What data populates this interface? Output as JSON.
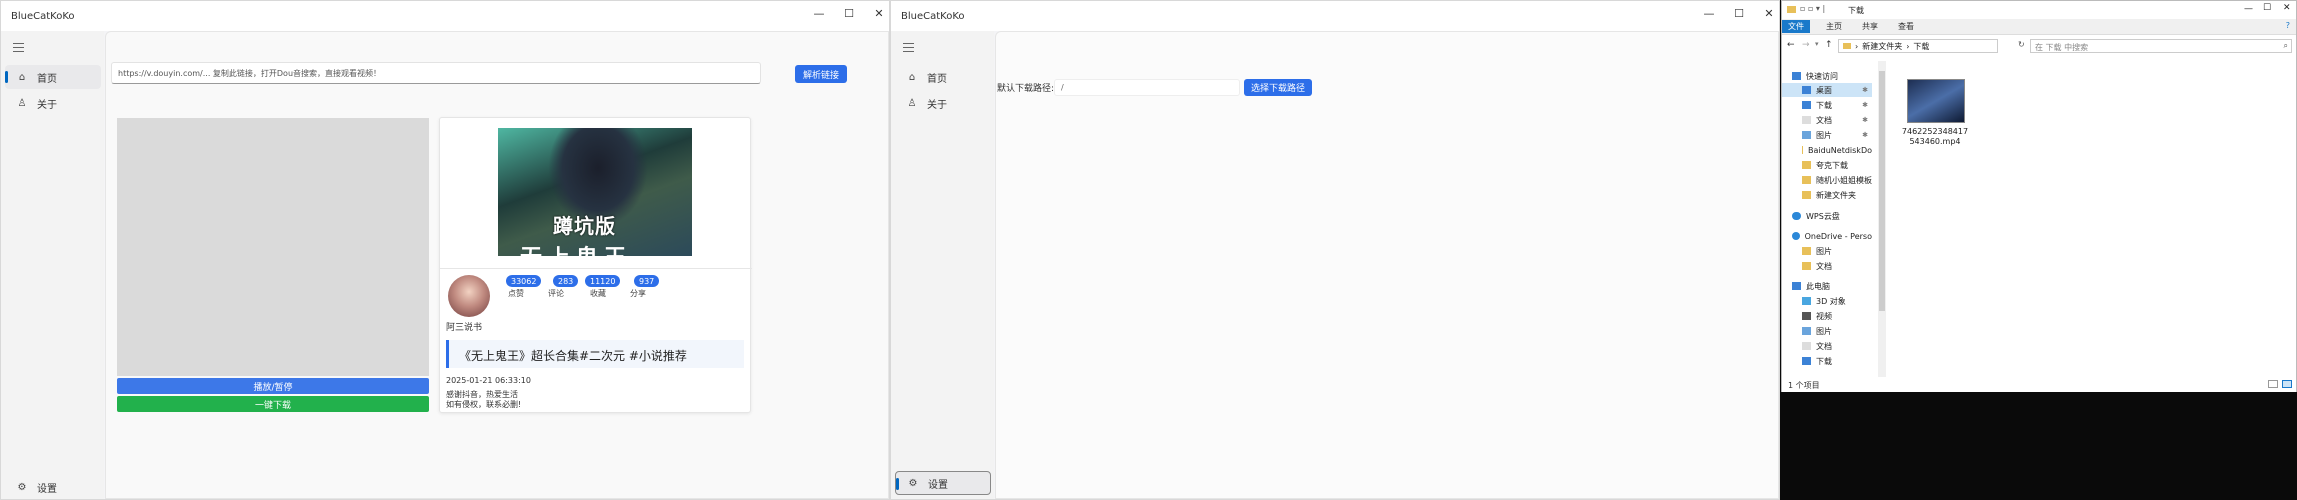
{
  "window1": {
    "title": "BlueCatKoKo",
    "controls": {
      "minimize": "—",
      "maximize": "☐",
      "close": "✕"
    },
    "nav": [
      {
        "icon": "home-icon",
        "glyph": "⌂",
        "label": "首页"
      },
      {
        "icon": "user-icon",
        "glyph": "♙",
        "label": "关于"
      }
    ],
    "settings": {
      "glyph": "⚙",
      "label": "设置"
    },
    "url_input_value": "https://v.douyin.com/... 复制此链接，打开Dou音搜索，直接观看视频！",
    "parse_button": "解析链接",
    "play_button": "播放/暂停",
    "download_button": "一键下载",
    "cover_text": "蹲坑版",
    "cover_text_sub": "无上鬼王",
    "stats": [
      {
        "value": "33062",
        "label": "点赞"
      },
      {
        "value": "283",
        "label": "评论"
      },
      {
        "value": "11120",
        "label": "收藏"
      },
      {
        "value": "937",
        "label": "分享"
      }
    ],
    "author": "阿三说书",
    "video_title": "《无上鬼王》超长合集#二次元 #小说推荐",
    "date": "2025-01-21 06:33:10",
    "desc_line1": "感谢抖音，热爱生活",
    "desc_line2": "如有侵权，联系必删!"
  },
  "window2": {
    "title": "BlueCatKoKo",
    "controls": {
      "minimize": "—",
      "maximize": "☐",
      "close": "✕"
    },
    "nav": [
      {
        "icon": "home-icon",
        "glyph": "⌂",
        "label": "首页"
      },
      {
        "icon": "user-icon",
        "glyph": "♙",
        "label": "关于"
      }
    ],
    "settings": {
      "glyph": "⚙",
      "label": "设置"
    },
    "path_label": "默认下载路径:",
    "path_value": "/",
    "choose_button": "选择下载路径"
  },
  "explorer": {
    "title": "下载",
    "controls": {
      "minimize": "—",
      "maximize": "☐",
      "close": "✕"
    },
    "ribbon_tabs": [
      "文件",
      "主页",
      "共享",
      "查看"
    ],
    "breadcrumb": [
      "新建文件夹",
      "下载"
    ],
    "search_placeholder": "在 下载 中搜索",
    "tree": [
      "快速访问",
      "桌面",
      "下载",
      "文档",
      "图片",
      "BaiduNetdiskDo",
      "夸克下载",
      "随机小姐姐模板",
      "新建文件夹",
      "WPS云盘",
      "OneDrive - Perso",
      "图片",
      "文档",
      "此电脑",
      "3D 对象",
      "视频",
      "图片",
      "文档",
      "下载"
    ],
    "file_name_line1": "7462252348417",
    "file_name_line2": "543460.mp4",
    "status": "1 个项目"
  },
  "colors": {
    "accent": "#2d6ee9",
    "green": "#22b14c",
    "explorer_blue": "#1979ca"
  }
}
